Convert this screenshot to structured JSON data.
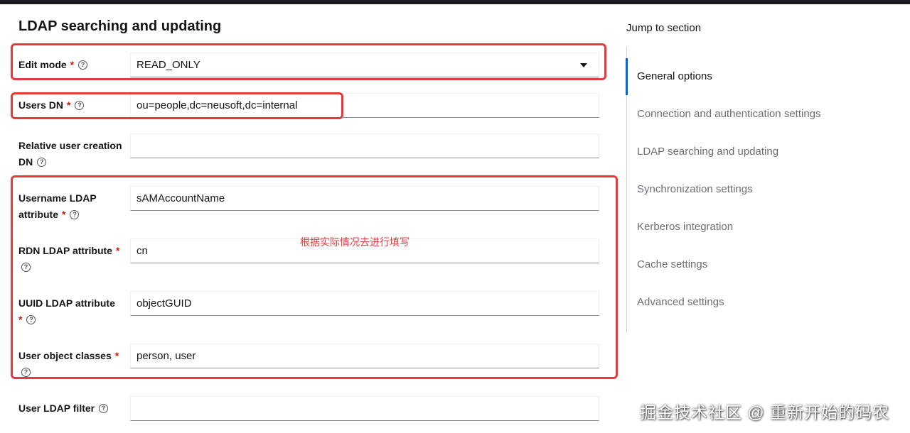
{
  "section_title": "LDAP searching and updating",
  "colors": {
    "required": "#c9190b",
    "annotation_box": "#e5393b",
    "active_nav": "#0066cc"
  },
  "fields": {
    "edit_mode": {
      "label": "Edit mode",
      "required": "*",
      "value": "READ_ONLY"
    },
    "users_dn": {
      "label": "Users DN",
      "required": "*",
      "value": "ou=people,dc=neusoft,dc=internal"
    },
    "relative_user_creation_dn": {
      "label": "Relative user creation DN",
      "value": ""
    },
    "username_ldap_attribute": {
      "label": "Username LDAP attribute",
      "required": "*",
      "value": "sAMAccountName"
    },
    "rdn_ldap_attribute": {
      "label": "RDN LDAP attribute",
      "required": "*",
      "value": "cn"
    },
    "uuid_ldap_attribute": {
      "label": "UUID LDAP attribute",
      "required": "*",
      "value": "objectGUID"
    },
    "user_object_classes": {
      "label": "User object classes",
      "required": "*",
      "value": "person, user"
    },
    "user_ldap_filter": {
      "label": "User LDAP filter",
      "value": ""
    }
  },
  "help_icon": "?",
  "annotation": "根据实际情况去进行填写",
  "jump": {
    "title": "Jump to section",
    "items": [
      "General options",
      "Connection and authentication settings",
      "LDAP searching and updating",
      "Synchronization settings",
      "Kerberos integration",
      "Cache settings",
      "Advanced settings"
    ]
  },
  "watermark": "掘金技术社区 @ 重新开始的码农"
}
